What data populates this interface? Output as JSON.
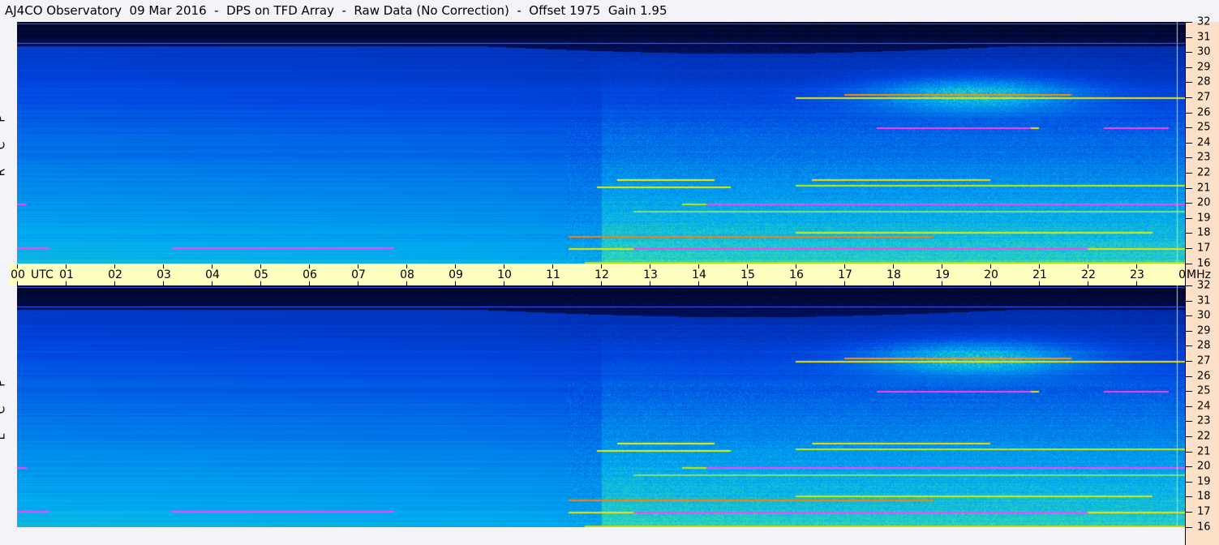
{
  "header": {
    "title": "AJ4CO Observatory  09 Mar 2016  -  DPS on TFD Array  -  Raw Data (No Correction)  -  Offset 1975  Gain 1.95"
  },
  "chart_data": {
    "type": "heatmap",
    "title": "AJ4CO Observatory  09 Mar 2016  -  DPS on TFD Array  -  Raw Data (No Correction)  -  Offset 1975  Gain 1.95",
    "panels": [
      {
        "label": [
          "R",
          "C",
          "P"
        ],
        "name": "RCP"
      },
      {
        "label": [
          "L",
          "C",
          "P"
        ],
        "name": "LCP"
      }
    ],
    "x_axis": {
      "unit_label": "UTC",
      "ticks": [
        "00",
        "01",
        "02",
        "03",
        "04",
        "05",
        "06",
        "07",
        "08",
        "09",
        "10",
        "11",
        "12",
        "13",
        "14",
        "15",
        "16",
        "17",
        "18",
        "19",
        "20",
        "21",
        "22",
        "23",
        "00"
      ],
      "range_hours": [
        0,
        24
      ]
    },
    "y_axis": {
      "unit_label": "MHz",
      "ticks": [
        "32",
        "31",
        "30",
        "29",
        "28",
        "27",
        "26",
        "25",
        "24",
        "23",
        "22",
        "21",
        "20",
        "19",
        "18",
        "17",
        "16"
      ],
      "range_mhz": [
        16,
        32
      ]
    },
    "colormap": [
      "#000000",
      "#001a80",
      "#0050e0",
      "#00b4f0",
      "#40e0a0",
      "#f0f000",
      "#ff8000",
      "#ff00ff"
    ]
  }
}
